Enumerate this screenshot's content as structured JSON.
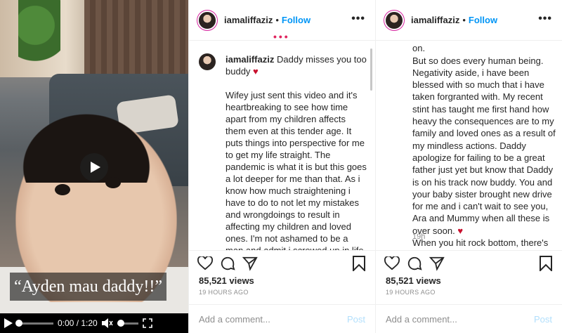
{
  "video": {
    "caption": "“Ayden mau daddy!!”",
    "time": "0:00 / 1:20",
    "progress": 0,
    "volume": 0.0
  },
  "post1": {
    "username": "iamaliffaziz",
    "follow_label": "Follow",
    "more": "•••",
    "comment_username": "iamaliffaziz",
    "comment_first": "Daddy misses you too buddy",
    "comment_heart": "♥",
    "comment_paragraph": "Wifey just sent this video and it's heartbreaking to see how time apart from my children affects them even at this tender age. It puts things into perspective for me to get my life straight. The pandemic is what it is but this goes a lot deeper for me than that. As i know how much straightening i have to do to not let my mistakes and wrongdoings to result in affecting my children and loved ones. I'm not ashamed to be a man and admit i screwed up in life many times over. Yes, i have many flaws to reflect on. But so does every human being.",
    "likes": "85,521 views",
    "ago": "19 HOURS AGO",
    "add_comment_placeholder": "Add a comment...",
    "post_label": "Post"
  },
  "post2": {
    "username": "iamaliffaziz",
    "follow_label": "Follow",
    "more": "•••",
    "comment_text_part1": "Yes, i have many flaws to reflect on.\nBut so does every human being.\nNegativity aside, i have been blessed with so much that i have taken forgranted with. My recent stint has taught me first hand how heavy the consequences are to my family and loved ones as a result of my mindless actions. Daddy apologize for failing to be a great father just yet but know that Daddy is on his track now buddy. You and your baby sister brought new drive for me and i can't wait to see you, Ara and Mummy when all these is over soon. ",
    "comment_heart": "♥",
    "comment_text_part2": "\nWhen you hit rock bottom, there's nowhere else but up.\nInsyaallahuta'ala.",
    "timestamp": "19h",
    "likes": "85,521 views",
    "ago": "19 HOURS AGO",
    "add_comment_placeholder": "Add a comment...",
    "post_label": "Post"
  },
  "colors": {
    "follow": "#0095f6",
    "heart": "#c8102e",
    "post_disabled": "#b2dffc",
    "muted": "#8e8e8e"
  }
}
